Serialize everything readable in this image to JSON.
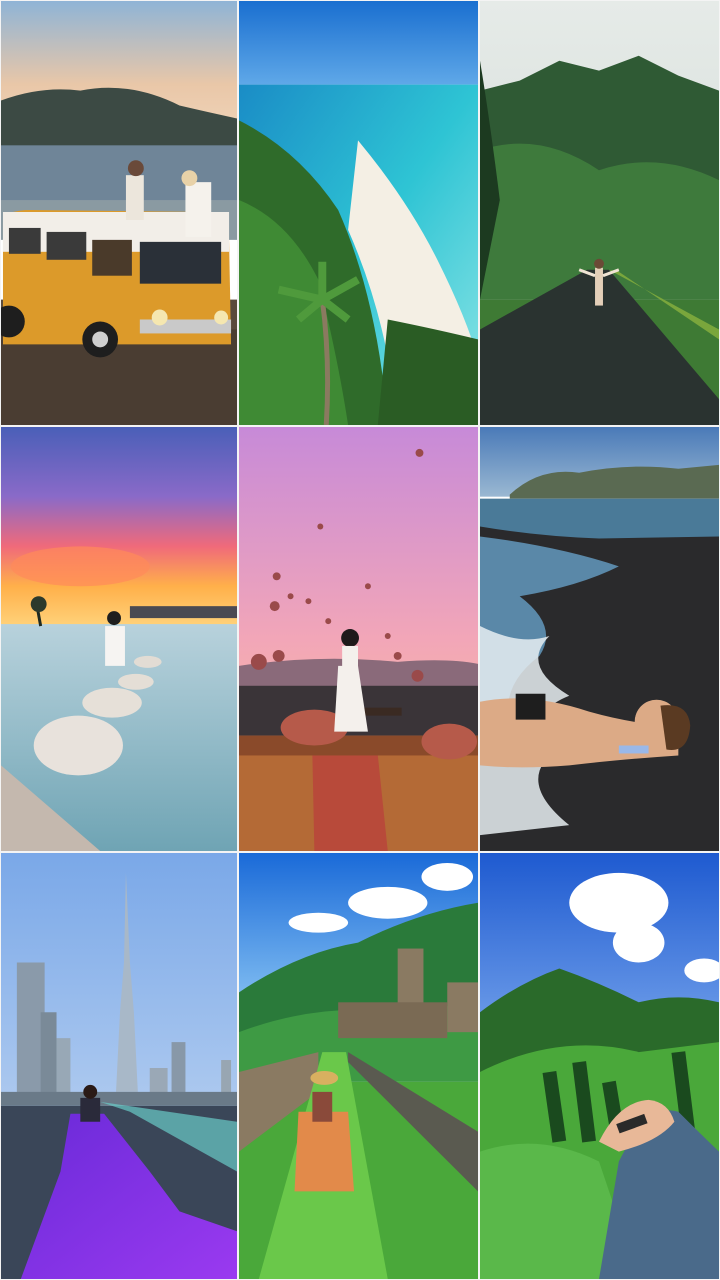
{
  "collage": {
    "tiles": [
      {
        "scene": "orange-camper-van-by-sea",
        "description_icon": "van-icon"
      },
      {
        "scene": "tropical-beach-aerial",
        "description_icon": "palm-icon"
      },
      {
        "scene": "green-mountain-road",
        "description_icon": "mountain-icon"
      },
      {
        "scene": "infinity-pool-sunset",
        "description_icon": "sunset-icon"
      },
      {
        "scene": "hot-air-balloons-terrace",
        "description_icon": "balloon-icon"
      },
      {
        "scene": "black-sand-beach",
        "description_icon": "wave-icon"
      },
      {
        "scene": "city-skyscraper-purple-dress",
        "description_icon": "tower-icon"
      },
      {
        "scene": "castle-garden-path",
        "description_icon": "castle-icon"
      },
      {
        "scene": "green-valley-hand",
        "description_icon": "hand-icon"
      }
    ]
  }
}
